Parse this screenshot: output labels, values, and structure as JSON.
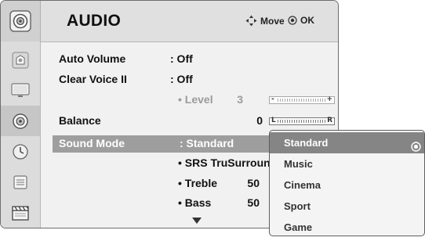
{
  "header": {
    "title": "AUDIO",
    "move_label": "Move",
    "ok_label": "OK"
  },
  "sidebar": {
    "logo_icon": "speaker-icon",
    "categories": [
      {
        "icon": "picture-icon"
      },
      {
        "icon": "screen-icon"
      },
      {
        "icon": "audio-icon",
        "selected": true
      },
      {
        "icon": "clock-icon"
      },
      {
        "icon": "option-icon"
      },
      {
        "icon": "clapperboard-icon"
      }
    ]
  },
  "settings": {
    "auto_volume": {
      "label": "Auto Volume",
      "value": ": Off"
    },
    "clear_voice": {
      "label": "Clear Voice II",
      "value": ": Off"
    },
    "level": {
      "label": "• Level",
      "value": "3",
      "minus": "-",
      "plus": "+"
    },
    "balance": {
      "label": "Balance",
      "value": "0",
      "left": "L",
      "right": "R"
    },
    "sound_mode": {
      "label": "Sound Mode",
      "value": ": Standard"
    },
    "srs": {
      "label": "• SRS TruSurround XT"
    },
    "treble": {
      "label": "• Treble",
      "value": "50"
    },
    "bass": {
      "label": "• Bass",
      "value": "50"
    }
  },
  "dropdown": {
    "options": [
      "Standard",
      "Music",
      "Cinema",
      "Sport",
      "Game"
    ],
    "selected": "Standard"
  },
  "colors": {
    "highlight": "#9e9e9e",
    "dropdown_selected": "#858585",
    "panel": "#f1f1f1"
  }
}
